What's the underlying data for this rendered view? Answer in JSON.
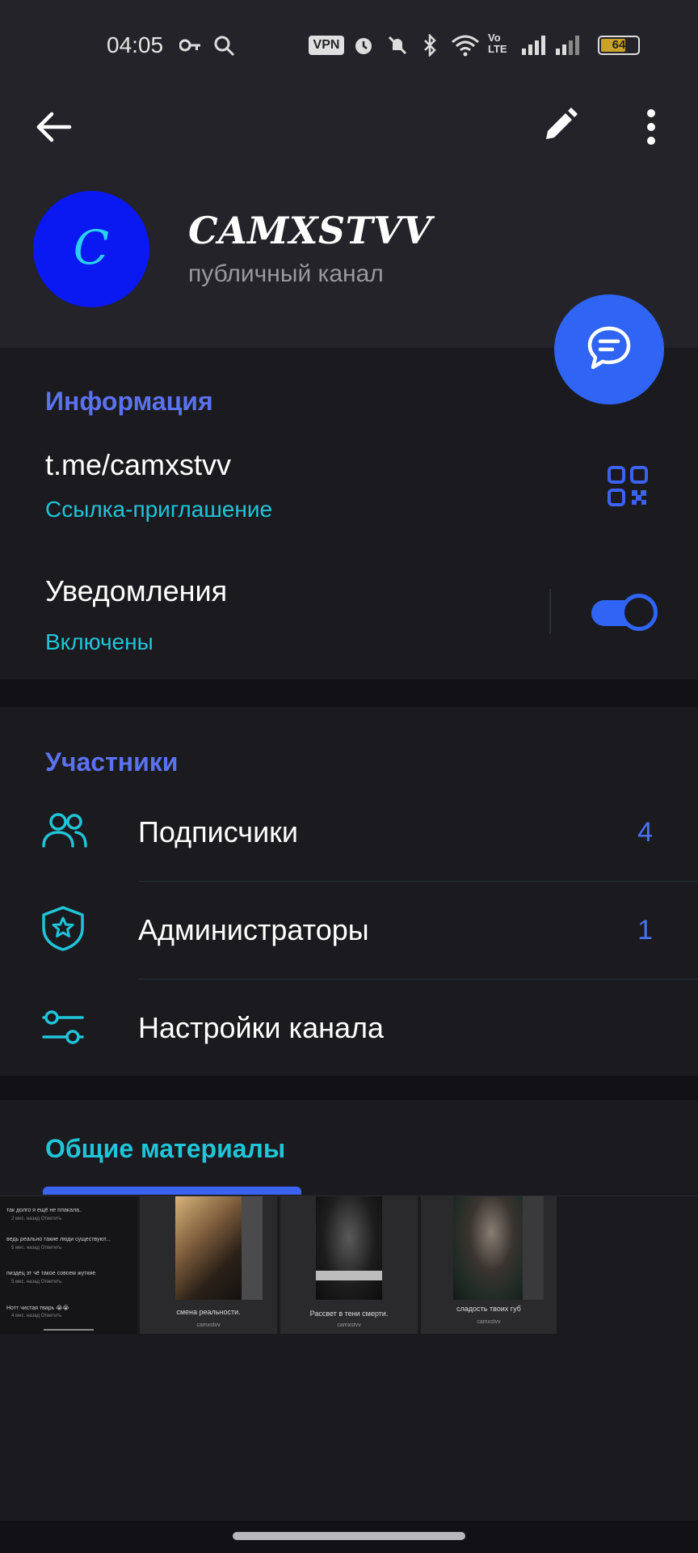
{
  "status_bar": {
    "time": "04:05",
    "vpn_label": "VPN",
    "volte_label": "Vo LTE",
    "battery_level": "64",
    "icons": [
      "key-icon",
      "search-icon",
      "vpn-icon",
      "alarm-icon",
      "mute-icon",
      "bluetooth-icon",
      "wifi-icon",
      "volte-icon",
      "signal-icon",
      "battery-icon"
    ]
  },
  "toolbar": {
    "icons": [
      "back-arrow-icon",
      "edit-pencil-icon",
      "more-vert-icon"
    ]
  },
  "channel": {
    "avatar_letter": "C",
    "name": "CAMXSTVV",
    "type": "публичный канал",
    "avatar_color": "#0a18f2"
  },
  "info": {
    "title": "Информация",
    "link": "t.me/camxstvv",
    "link_caption": "Ссылка-приглашение",
    "notifications_label": "Уведомления",
    "notifications_status": "Включены",
    "notifications_on": true
  },
  "members": {
    "title": "Участники",
    "items": [
      {
        "label": "Подписчики",
        "count": "4",
        "icon": "people-icon"
      },
      {
        "label": "Администраторы",
        "count": "1",
        "icon": "shield-star-icon"
      },
      {
        "label": "Настройки канала",
        "count": "",
        "icon": "sliders-icon"
      }
    ]
  },
  "shared": {
    "title": "Общие материалы",
    "thumbnails": [
      {
        "caption": "",
        "author": ""
      },
      {
        "caption": "смена реальности.",
        "author": "camxstvv"
      },
      {
        "caption": "Рассвет в тени смерти.",
        "author": "camxstvv"
      },
      {
        "caption": "сладость твоих губ",
        "author": "camxstvv"
      }
    ],
    "comments": [
      {
        "text": "так долго я ещё не плакала..",
        "meta": "2 мес. назад  Ответить"
      },
      {
        "text": "ведь реально такие люди существуют...",
        "meta": "5 мес. назад  Ответить"
      },
      {
        "text": "пиздец эт чё такое совсем жуткие",
        "meta": "5 мес. назад  Ответить"
      },
      {
        "text": "Нотт чистая тварь 😭😭",
        "meta": "4 мес. назад  Ответить"
      }
    ]
  },
  "colors": {
    "accent_blue": "#2f64f5",
    "accent_cyan": "#1fc5d8",
    "section_title_blue": "#5b72f0",
    "background": "#1b1a1f",
    "header_bg": "#242329"
  }
}
